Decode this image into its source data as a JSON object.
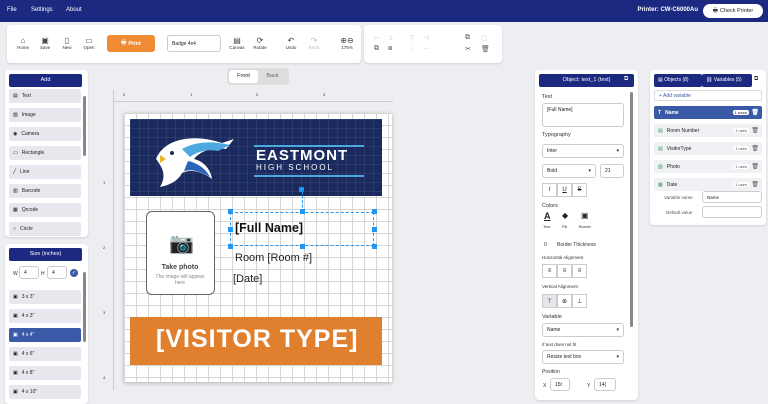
{
  "menu": {
    "file": "File",
    "settings": "Settings",
    "about": "About",
    "printer": "Printer: CW-C6000Au",
    "check_printer": "Check Printer"
  },
  "toolbar": {
    "home": "Home",
    "save": "Save",
    "new": "New",
    "open": "Open",
    "print": "Print",
    "badge_size": "Badge 4x4",
    "canvas": "Canvas",
    "rotate": "Rotate",
    "undo": "Undo",
    "redo": "Redo",
    "zoom": "175%"
  },
  "sides": {
    "front": "Front",
    "back": "Back"
  },
  "add_panel": {
    "title": "Add",
    "items": [
      "Text",
      "Image",
      "Camera",
      "Rectangle",
      "Line",
      "Barcode",
      "Qrcode",
      "Circle"
    ]
  },
  "size_panel": {
    "title": "Size (inches)",
    "w_label": "W",
    "w_value": "4",
    "h_label": "H",
    "h_value": "4",
    "sizes": [
      "3 x 3\"",
      "4 x 3\"",
      "4 x 4\"",
      "4 x 6\"",
      "4 x 8\"",
      "4 x 10\""
    ],
    "active_index": 2
  },
  "rulers": {
    "top": [
      "0",
      "1",
      "2",
      "3"
    ],
    "left": [
      "1",
      "2",
      "3",
      "4"
    ]
  },
  "badge": {
    "school_name": "EASTMONT",
    "school_sub": "HIGH SCHOOL",
    "photo_title": "Take photo",
    "photo_sub": "The image will appear here",
    "full_name": "[Full Name]",
    "room": "Room [Room #]",
    "date": "[Date]",
    "visitor_type": "[VISITOR TYPE]",
    "header_color": "#1a2a5e",
    "footer_color": "#e07f2e"
  },
  "props": {
    "title": "Object: text_1 (text)",
    "text_label": "Text",
    "text_value": "[Full Name]",
    "typography": "Typography",
    "font": "Inter",
    "weight": "Bold",
    "size": "21",
    "colors": "Colors",
    "color_labels": [
      "Text",
      "Fill",
      "Border"
    ],
    "border_thickness_value": "0",
    "border_thickness_label": "Border Thickness",
    "h_align": "Horizontal Alignment",
    "v_align": "Vertical Alignment",
    "variable_label": "Variable",
    "variable_value": "Name",
    "overflow_label": "If text does not fit",
    "overflow_value": "Resize text box",
    "position_label": "Position",
    "x_label": "X",
    "x_value": "15t",
    "y_label": "Y",
    "y_value": "14("
  },
  "vars": {
    "objects_tab": "Objects (8)",
    "variables_tab": "Variables (5)",
    "add_variable": "+ Add variable",
    "items": [
      {
        "name": "Name",
        "uses": "1 uses"
      },
      {
        "name": "Room Number",
        "uses": "1 uses"
      },
      {
        "name": "VisitorType",
        "uses": "1 uses"
      },
      {
        "name": "Photo",
        "uses": "1 uses"
      },
      {
        "name": "Date",
        "uses": "1 uses"
      }
    ],
    "var_name_label": "Variable name",
    "var_name_value": "Name",
    "default_label": "Default value"
  }
}
